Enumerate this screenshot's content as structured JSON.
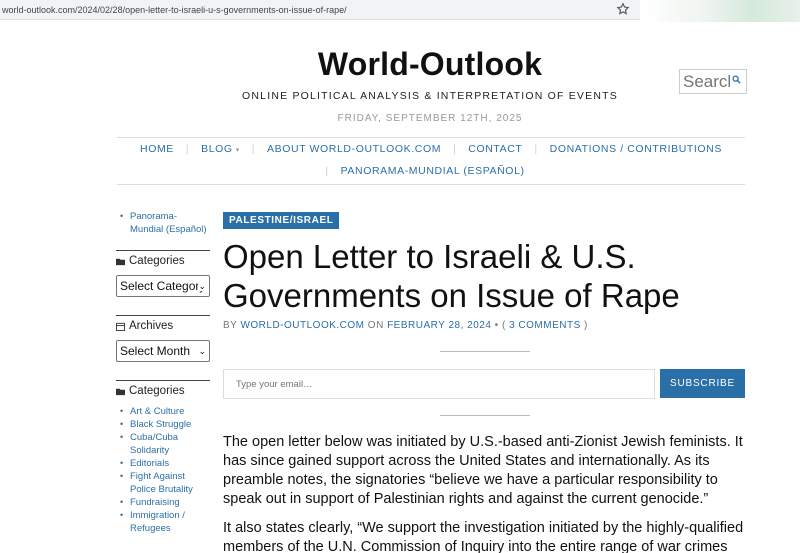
{
  "browser": {
    "url": "world-outlook.com/2024/02/28/open-letter-to-israeli-u-s-governments-on-issue-of-rape/"
  },
  "site": {
    "title": "World-Outlook",
    "tagline": "ONLINE POLITICAL ANALYSIS & INTERPRETATION OF EVENTS",
    "date": "FRIDAY, SEPTEMBER 12TH, 2025"
  },
  "search": {
    "placeholder": "Search"
  },
  "nav": {
    "items": [
      {
        "label": "HOME"
      },
      {
        "label": "BLOG"
      },
      {
        "label": "ABOUT WORLD-OUTLOOK.COM"
      },
      {
        "label": "CONTACT"
      },
      {
        "label": "DONATIONS / CONTRIBUTIONS"
      },
      {
        "label": "PANORAMA-MUNDIAL (ESPAÑOL)"
      }
    ]
  },
  "sidebar": {
    "top_link": "Panorama-Mundial (Español)",
    "categories_title": "Categories",
    "categories_select": "Select Category",
    "archives_title": "Archives",
    "archives_select": "Select Month",
    "categories_list_title": "Categories",
    "categories_list": [
      "Art & Culture",
      "Black Struggle",
      "Cuba/Cuba Solidarity",
      "Editorials",
      "Fight Against Police Brutality",
      "Fundraising",
      "Immigration / Refugees"
    ]
  },
  "post": {
    "category": "PALESTINE/ISRAEL",
    "title": "Open Letter to Israeli & U.S. Governments on Issue of Rape",
    "meta": {
      "by": "BY",
      "author": "WORLD-OUTLOOK.COM",
      "on": "ON",
      "date": "FEBRUARY 28, 2024",
      "bullet": "•",
      "comments_open": "(",
      "comments": "3 COMMENTS",
      "comments_close": ")"
    },
    "paragraphs": [
      "The open letter below was initiated by U.S.-based anti-Zionist Jewish feminists. It has since gained support across the United States and internationally. As its preamble notes, the signatories “believe we have a particular responsibility to speak out in support of Palestinian rights and against the current genocide.”",
      "It also states clearly, “We support the investigation initiated by the highly-qualified members of the U.N. Commission of Inquiry into the entire range of war crimes"
    ]
  },
  "subscribe": {
    "email_placeholder": "Type your email…",
    "button_label": "SUBSCRIBE"
  },
  "colors": {
    "accent": "#2b6fa8",
    "text": "#111111",
    "muted": "#999999"
  }
}
